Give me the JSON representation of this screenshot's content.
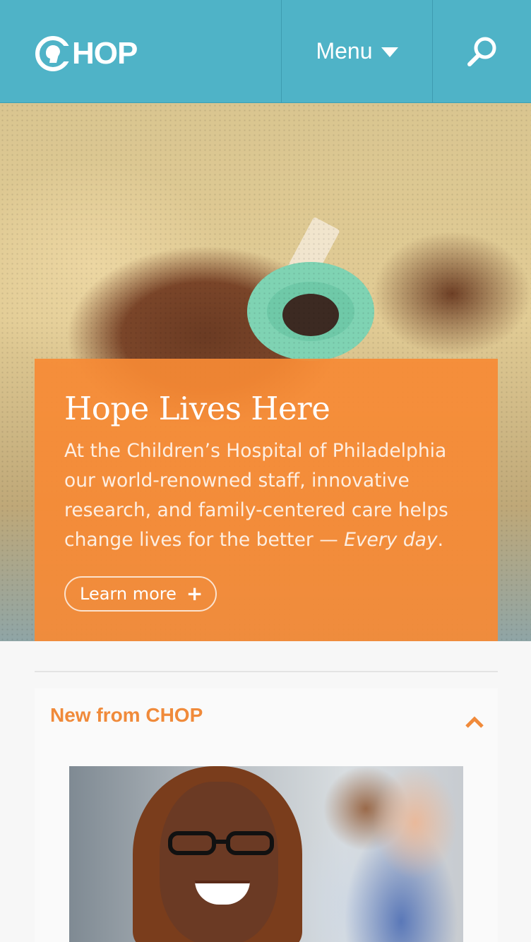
{
  "header": {
    "logo_text": "HOP",
    "logo_full": "CHOP",
    "menu_label": "Menu",
    "menu_icon": "caret-down-icon",
    "search_icon": "search-icon",
    "background_color": "#4fb3c7"
  },
  "hero": {
    "title": "Hope Lives Here",
    "body_text": "At the Children’s Hospital of Philadelphia our world-renowned staff, innovative research, and family-centered care helps change lives for the better — ",
    "body_emphasis": "Every day",
    "body_end": ".",
    "cta_label": "Learn more",
    "cta_icon": "plus-icon",
    "card_color": "#f78a34"
  },
  "news": {
    "title": "New from CHOP",
    "toggle_icon": "chevron-up-icon",
    "accent_color": "#f08a3a"
  }
}
